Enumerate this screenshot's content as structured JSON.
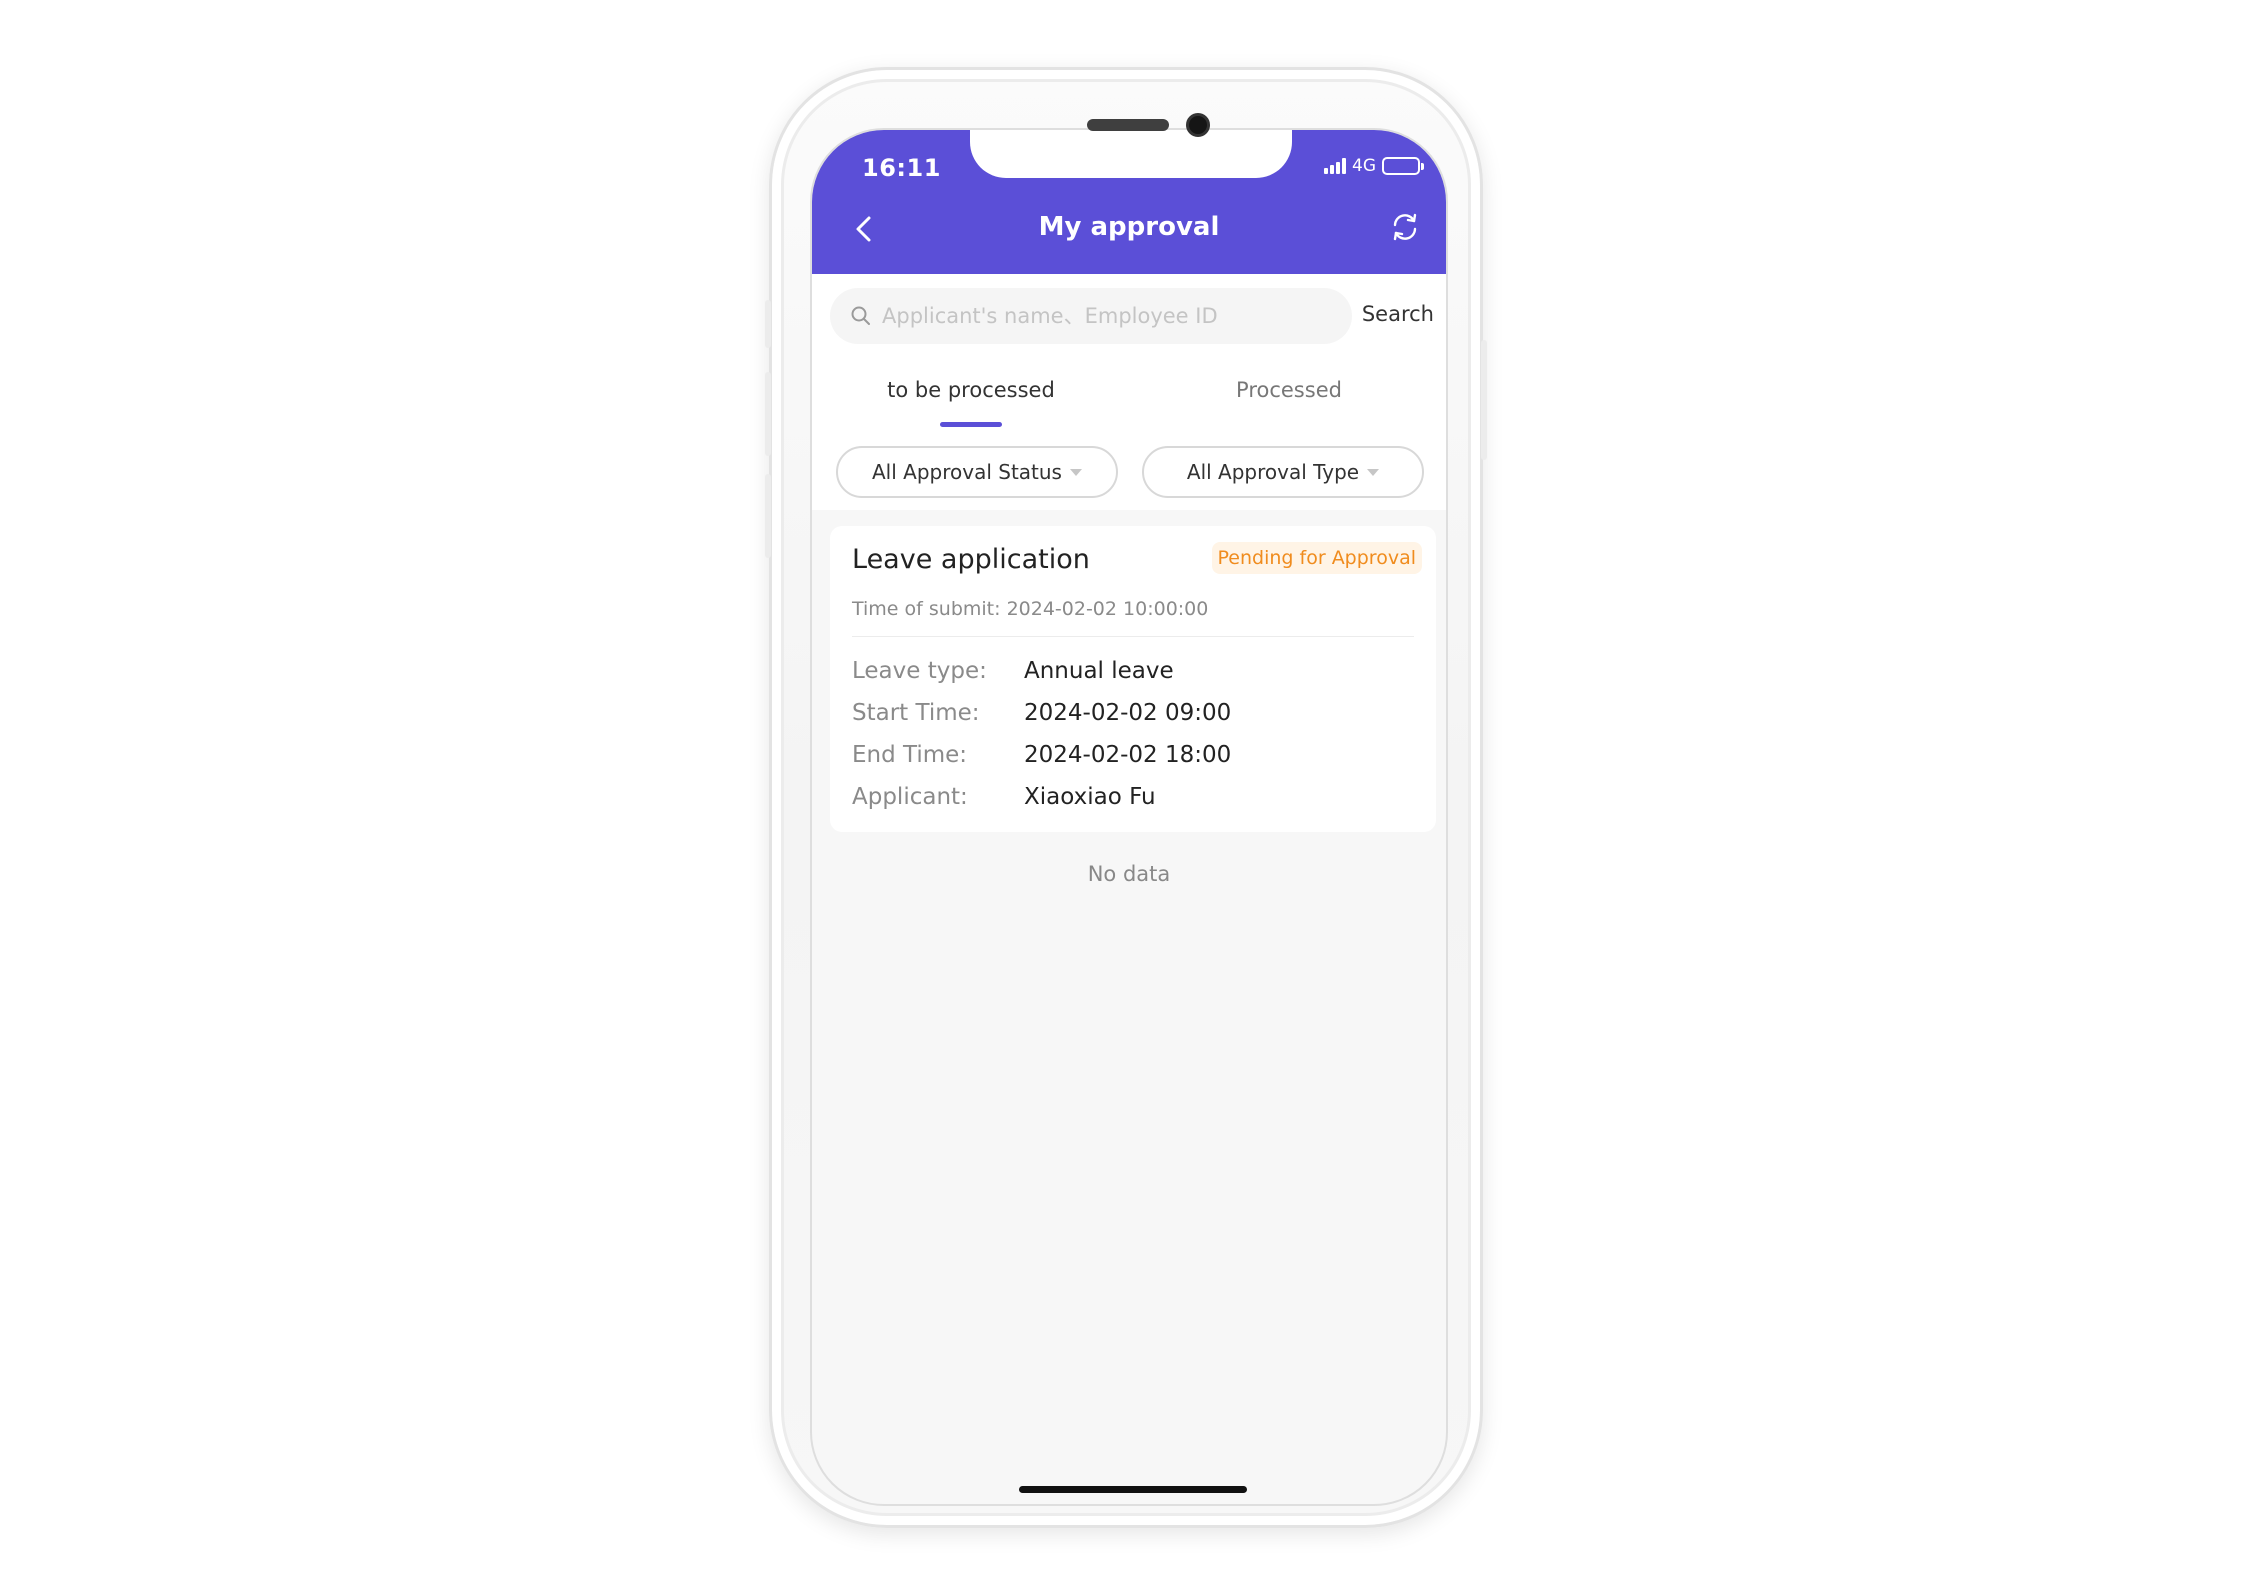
{
  "status_bar": {
    "time": "16:11",
    "network": "4G",
    "battery_level": 0.35
  },
  "header": {
    "title": "My approval",
    "back_icon": "chevron-left-icon",
    "refresh_icon": "refresh-icon"
  },
  "search": {
    "placeholder": "Applicant's name、Employee ID",
    "value": "",
    "button_label": "Search",
    "icon": "search-icon"
  },
  "tabs": [
    {
      "label": "to be processed",
      "active": true
    },
    {
      "label": "Processed",
      "active": false
    }
  ],
  "filters": {
    "status": "All Approval Status",
    "type": "All Approval Type"
  },
  "card": {
    "title": "Leave application",
    "badge": "Pending for Approval",
    "submit_time": "Time of submit: 2024-02-02 10:00:00",
    "rows": [
      {
        "label": "Leave type:",
        "value": "Annual leave"
      },
      {
        "label": "Start Time:",
        "value": "2024-02-02 09:00"
      },
      {
        "label": "End Time:",
        "value": "2024-02-02 18:00"
      },
      {
        "label": "Applicant:",
        "value": "Xiaoxiao Fu"
      }
    ]
  },
  "empty_message": "No data",
  "colors": {
    "accent": "#5b4fd7",
    "badge_text": "#f08c1e",
    "badge_bg": "#fff4e6",
    "background": "#f7f7f7"
  }
}
